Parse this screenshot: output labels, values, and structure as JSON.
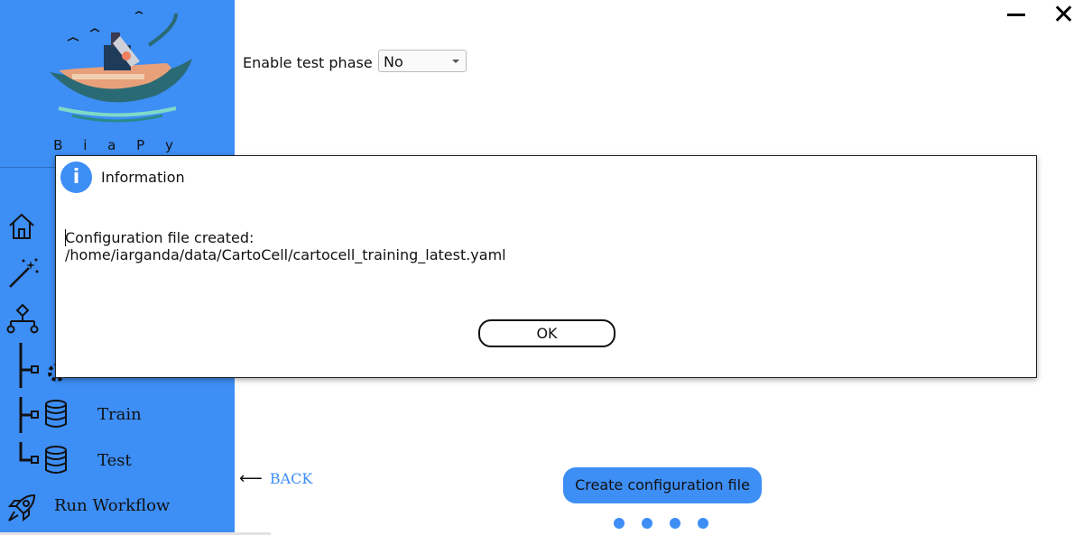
{
  "sidebar": {
    "brand": "B i a P y",
    "nav": {
      "train_label": "Train",
      "test_label": "Test",
      "run_label": "Run Workflow"
    }
  },
  "window": {
    "minimize_icon": "minimize-icon",
    "close_icon": "close-icon"
  },
  "main": {
    "test_phase_label": "Enable test phase",
    "test_phase_value": "No",
    "back_label": "BACK",
    "create_button_label": "Create configuration file",
    "page_dots": 4
  },
  "dialog": {
    "title": "Information",
    "message_line1": "Configuration file created:",
    "message_line2": "/home/iarganda/data/CartoCell/cartocell_training_latest.yaml",
    "ok_label": "OK"
  },
  "colors": {
    "accent": "#3d8ef5"
  }
}
